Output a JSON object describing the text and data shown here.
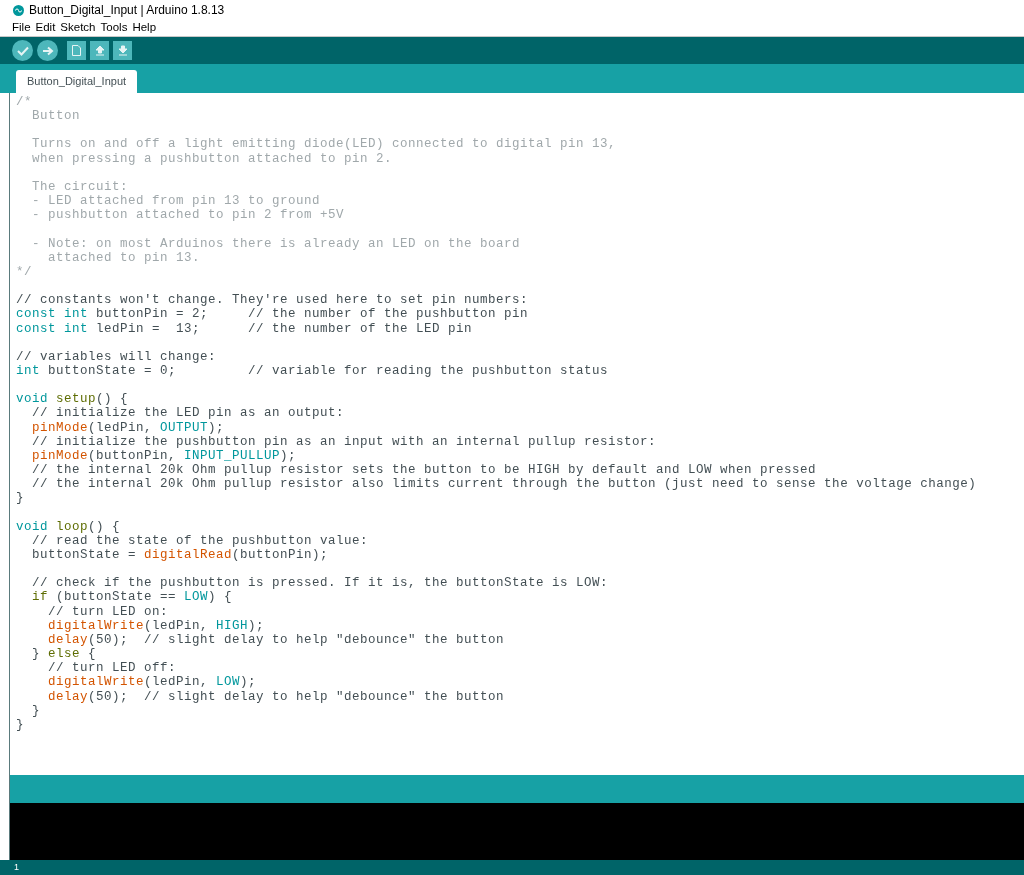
{
  "window": {
    "title": "Button_Digital_Input | Arduino 1.8.13"
  },
  "menu": [
    "File",
    "Edit",
    "Sketch",
    "Tools",
    "Help"
  ],
  "toolbar": [
    {
      "kind": "verify"
    },
    {
      "kind": "upload"
    },
    {
      "kind": "new"
    },
    {
      "kind": "open"
    },
    {
      "kind": "save"
    }
  ],
  "tabs": [
    {
      "label": "Button_Digital_Input",
      "selected": true
    }
  ],
  "code_blocks": [
    [
      [
        {
          "kind": "comment",
          "text": "/*"
        }
      ],
      [
        {
          "kind": "comment",
          "text": "  Button"
        }
      ]
    ],
    [
      [
        {
          "kind": "comment",
          "text": "  Turns on and off a light emitting diode(LED) connected to digital pin 13,"
        }
      ],
      [
        {
          "kind": "comment",
          "text": "  when pressing a pushbutton attached to pin 2."
        }
      ]
    ],
    [
      [
        {
          "kind": "comment",
          "text": "  The circuit:"
        }
      ],
      [
        {
          "kind": "comment",
          "text": "  - LED attached from pin 13 to ground"
        }
      ],
      [
        {
          "kind": "comment",
          "text": "  - pushbutton attached to pin 2 from +5V"
        }
      ]
    ],
    [
      [
        {
          "kind": "comment",
          "text": "  - Note: on most Arduinos there is already an LED on the board"
        }
      ],
      [
        {
          "kind": "comment",
          "text": "    attached to pin 13."
        }
      ],
      [
        {
          "kind": "comment",
          "text": "*/"
        }
      ]
    ],
    [
      [
        {
          "kind": "plain",
          "text": "// constants won't change. They're used here to set pin numbers:"
        }
      ],
      [
        {
          "kind": "keyword",
          "text": "const int"
        },
        {
          "kind": "plain",
          "text": " buttonPin = 2;     // the number of the pushbutton pin"
        }
      ],
      [
        {
          "kind": "keyword",
          "text": "const int"
        },
        {
          "kind": "plain",
          "text": " ledPin =  13;      // the number of the LED pin"
        }
      ]
    ],
    [
      [
        {
          "kind": "plain",
          "text": "// variables will change:"
        }
      ],
      [
        {
          "kind": "keyword",
          "text": "int"
        },
        {
          "kind": "plain",
          "text": " buttonState = 0;         // variable for reading the pushbutton status"
        }
      ]
    ],
    [
      [
        {
          "kind": "keyword",
          "text": "void"
        },
        {
          "kind": "structure",
          "text": " setup"
        },
        {
          "kind": "plain",
          "text": "() {"
        }
      ],
      [
        {
          "kind": "plain",
          "text": "  // initialize the LED pin as an output:"
        }
      ],
      [
        {
          "kind": "function",
          "text": "  pinMode"
        },
        {
          "kind": "plain",
          "text": "(ledPin, "
        },
        {
          "kind": "constant",
          "text": "OUTPUT"
        },
        {
          "kind": "plain",
          "text": ");"
        }
      ],
      [
        {
          "kind": "plain",
          "text": "  // initialize the pushbutton pin as an input with an internal pullup resistor:"
        }
      ],
      [
        {
          "kind": "function",
          "text": "  pinMode"
        },
        {
          "kind": "plain",
          "text": "(buttonPin, "
        },
        {
          "kind": "constant",
          "text": "INPUT_PULLUP"
        },
        {
          "kind": "plain",
          "text": ");"
        }
      ],
      [
        {
          "kind": "plain",
          "text": "  // the internal 20k Ohm pullup resistor sets the button to be HIGH by default and LOW when pressed"
        }
      ],
      [
        {
          "kind": "plain",
          "text": "  // the internal 20k Ohm pullup resistor also limits current through the button (just need to sense the voltage change)"
        }
      ],
      [
        {
          "kind": "plain",
          "text": "}"
        }
      ]
    ],
    [
      [
        {
          "kind": "keyword",
          "text": "void"
        },
        {
          "kind": "structure",
          "text": " loop"
        },
        {
          "kind": "plain",
          "text": "() {"
        }
      ],
      [
        {
          "kind": "plain",
          "text": "  // read the state of the pushbutton value:"
        }
      ],
      [
        {
          "kind": "plain",
          "text": "  buttonState = "
        },
        {
          "kind": "function",
          "text": "digitalRead"
        },
        {
          "kind": "plain",
          "text": "(buttonPin);"
        }
      ]
    ],
    [
      [
        {
          "kind": "plain",
          "text": "  // check if the pushbutton is pressed. If it is, the buttonState is LOW:"
        }
      ],
      [
        {
          "kind": "structure",
          "text": "  if"
        },
        {
          "kind": "plain",
          "text": " (buttonState == "
        },
        {
          "kind": "constant",
          "text": "LOW"
        },
        {
          "kind": "plain",
          "text": ") {"
        }
      ],
      [
        {
          "kind": "plain",
          "text": "    // turn LED on:"
        }
      ],
      [
        {
          "kind": "function",
          "text": "    digitalWrite"
        },
        {
          "kind": "plain",
          "text": "(ledPin, "
        },
        {
          "kind": "constant",
          "text": "HIGH"
        },
        {
          "kind": "plain",
          "text": ");"
        }
      ],
      [
        {
          "kind": "function",
          "text": "    delay"
        },
        {
          "kind": "plain",
          "text": "(50);  // slight delay to help \"debounce\" the button"
        }
      ],
      [
        {
          "kind": "plain",
          "text": "  } "
        },
        {
          "kind": "structure",
          "text": "else"
        },
        {
          "kind": "plain",
          "text": " {"
        }
      ],
      [
        {
          "kind": "plain",
          "text": "    // turn LED off:"
        }
      ],
      [
        {
          "kind": "function",
          "text": "    digitalWrite"
        },
        {
          "kind": "plain",
          "text": "(ledPin, "
        },
        {
          "kind": "constant",
          "text": "LOW"
        },
        {
          "kind": "plain",
          "text": ");"
        }
      ],
      [
        {
          "kind": "function",
          "text": "    delay"
        },
        {
          "kind": "plain",
          "text": "(50);  // slight delay to help \"debounce\" the button"
        }
      ],
      [
        {
          "kind": "plain",
          "text": "  }"
        }
      ],
      [
        {
          "kind": "plain",
          "text": "}"
        }
      ]
    ]
  ],
  "status_bar": {
    "line": "1"
  }
}
